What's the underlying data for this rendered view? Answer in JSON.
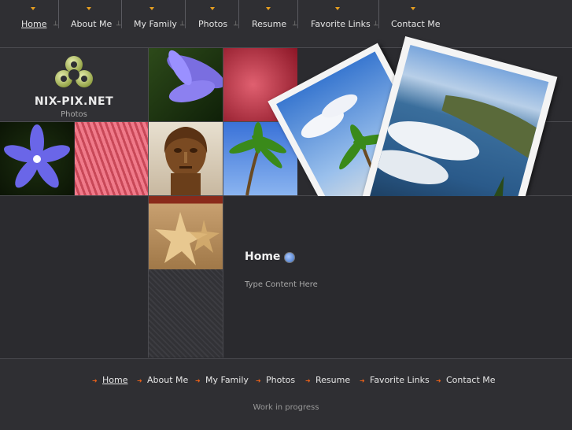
{
  "nav": {
    "items": [
      {
        "label": "Home",
        "active": true
      },
      {
        "label": "About Me"
      },
      {
        "label": "My Family"
      },
      {
        "label": "Photos"
      },
      {
        "label": "Resume"
      },
      {
        "label": "Favorite Links"
      },
      {
        "label": "Contact Me"
      }
    ]
  },
  "site": {
    "name": "NIX-PIX.NET",
    "subtitle": "Photos"
  },
  "main": {
    "title": "Home",
    "content": "Type Content Here"
  },
  "footer": {
    "items": [
      {
        "label": "Home",
        "active": true
      },
      {
        "label": "About Me"
      },
      {
        "label": "My Family"
      },
      {
        "label": "Photos"
      },
      {
        "label": "Resume"
      },
      {
        "label": "Favorite Links"
      },
      {
        "label": "Contact Me"
      }
    ],
    "note": "Work in progress"
  },
  "colors": {
    "accent_arrow": "#e8a020",
    "footer_arrow": "#e8601a",
    "background": "#2b2b2f"
  }
}
